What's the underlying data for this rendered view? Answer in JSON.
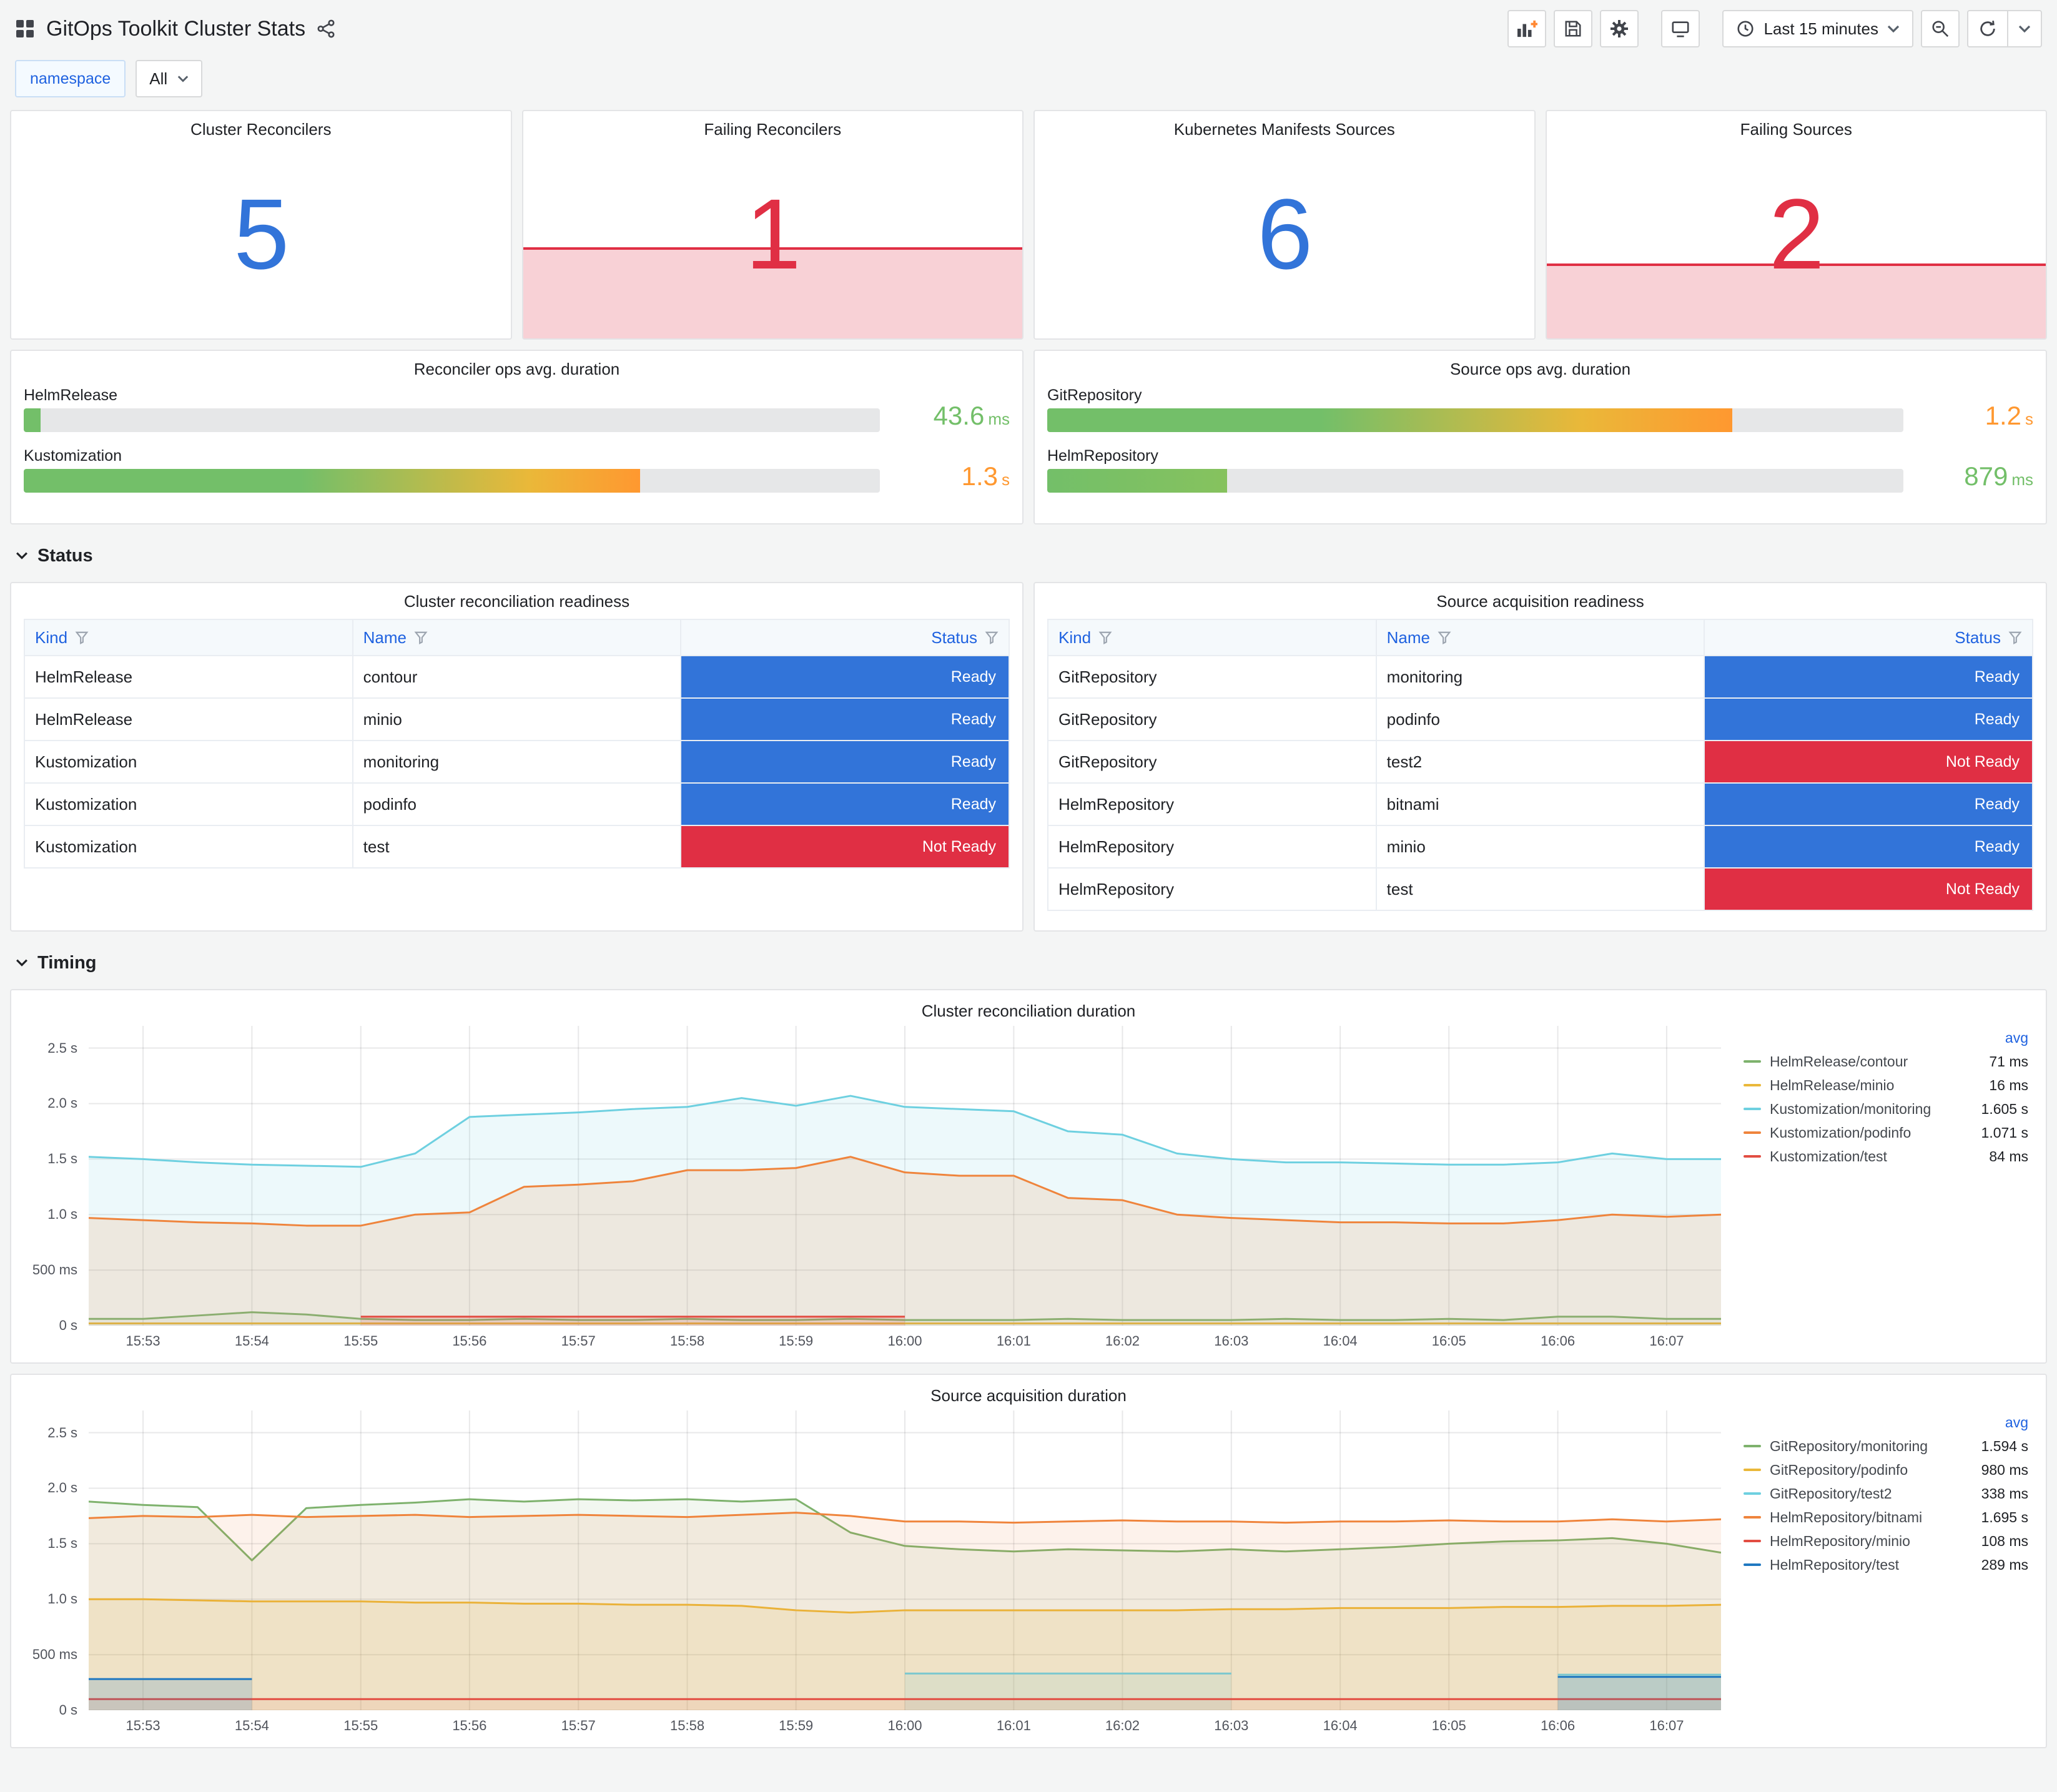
{
  "header": {
    "title": "GitOps Toolkit Cluster Stats",
    "time_range": "Last 15 minutes"
  },
  "variables": {
    "label": "namespace",
    "value": "All"
  },
  "sections": {
    "status": "Status",
    "timing": "Timing"
  },
  "icons": {
    "apps": "grid",
    "share": "share-network",
    "add_panel": "chart-plus",
    "save": "floppy",
    "settings": "gear",
    "tv": "monitor",
    "time": "clock",
    "zoom_out": "magnifier-minus",
    "refresh": "circular-arrow",
    "caret": "chevron-down",
    "filter": "funnel"
  },
  "stats": [
    {
      "title": "Cluster Reconcilers",
      "value": "5",
      "color": "#3274D9",
      "area_pct": 0
    },
    {
      "title": "Failing Reconcilers",
      "value": "1",
      "color": "#E02F44",
      "area_pct": 40,
      "area_color": "rgba(224,47,68,0.22)"
    },
    {
      "title": "Kubernetes Manifests Sources",
      "value": "6",
      "color": "#3274D9",
      "area_pct": 0
    },
    {
      "title": "Failing Sources",
      "value": "2",
      "color": "#E02F44",
      "area_pct": 33,
      "area_color": "rgba(224,47,68,0.22)"
    }
  ],
  "gauges": [
    {
      "title": "Reconciler ops avg. duration",
      "bars": [
        {
          "label": "HelmRelease",
          "value": "43.6",
          "unit": "ms",
          "fraction": 0.02,
          "color": "#73BF69",
          "gradient": [
            "#73BF69 0%",
            "#73BF69 100%"
          ]
        },
        {
          "label": "Kustomization",
          "value": "1.3",
          "unit": "s",
          "fraction": 0.72,
          "color": "#FF9830",
          "gradient": [
            "#73BF69 0%",
            "#73BF69 45%",
            "#EAB839 82%",
            "#FF9830 100%"
          ]
        }
      ]
    },
    {
      "title": "Source ops avg. duration",
      "bars": [
        {
          "label": "GitRepository",
          "value": "1.2",
          "unit": "s",
          "fraction": 0.8,
          "color": "#FF9830",
          "gradient": [
            "#73BF69 0%",
            "#73BF69 40%",
            "#EAB839 78%",
            "#FF9830 100%"
          ]
        },
        {
          "label": "HelmRepository",
          "value": "879",
          "unit": "ms",
          "fraction": 0.21,
          "color": "#73BF69",
          "gradient": [
            "#73BF69 0%",
            "#86C25E 100%"
          ]
        }
      ]
    }
  ],
  "status_section": {
    "status_colors": {
      "Ready": "#3274D9",
      "Not Ready": "#E02F44"
    },
    "tables": [
      {
        "title": "Cluster reconciliation readiness",
        "columns": [
          "Kind",
          "Name",
          "Status"
        ],
        "rows": [
          {
            "kind": "HelmRelease",
            "name": "contour",
            "status": "Ready"
          },
          {
            "kind": "HelmRelease",
            "name": "minio",
            "status": "Ready"
          },
          {
            "kind": "Kustomization",
            "name": "monitoring",
            "status": "Ready"
          },
          {
            "kind": "Kustomization",
            "name": "podinfo",
            "status": "Ready"
          },
          {
            "kind": "Kustomization",
            "name": "test",
            "status": "Not Ready"
          }
        ]
      },
      {
        "title": "Source acquisition readiness",
        "columns": [
          "Kind",
          "Name",
          "Status"
        ],
        "rows": [
          {
            "kind": "GitRepository",
            "name": "monitoring",
            "status": "Ready"
          },
          {
            "kind": "GitRepository",
            "name": "podinfo",
            "status": "Ready"
          },
          {
            "kind": "GitRepository",
            "name": "test2",
            "status": "Not Ready"
          },
          {
            "kind": "HelmRepository",
            "name": "bitnami",
            "status": "Ready"
          },
          {
            "kind": "HelmRepository",
            "name": "minio",
            "status": "Ready"
          },
          {
            "kind": "HelmRepository",
            "name": "test",
            "status": "Not Ready"
          }
        ]
      }
    ]
  },
  "chart_data": [
    {
      "type": "line",
      "title": "Cluster reconciliation duration",
      "legend_header": "avg",
      "ylim": [
        0,
        2.7
      ],
      "yticks": [
        {
          "v": 0,
          "label": "0 s"
        },
        {
          "v": 0.5,
          "label": "500 ms"
        },
        {
          "v": 1,
          "label": "1.0 s"
        },
        {
          "v": 1.5,
          "label": "1.5 s"
        },
        {
          "v": 2,
          "label": "2.0 s"
        },
        {
          "v": 2.5,
          "label": "2.5 s"
        }
      ],
      "xticks": [
        {
          "pos": 0.0333,
          "label": "15:53"
        },
        {
          "pos": 0.1,
          "label": "15:54"
        },
        {
          "pos": 0.1667,
          "label": "15:55"
        },
        {
          "pos": 0.2333,
          "label": "15:56"
        },
        {
          "pos": 0.3,
          "label": "15:57"
        },
        {
          "pos": 0.3667,
          "label": "15:58"
        },
        {
          "pos": 0.4333,
          "label": "15:59"
        },
        {
          "pos": 0.5,
          "label": "16:00"
        },
        {
          "pos": 0.5667,
          "label": "16:01"
        },
        {
          "pos": 0.6333,
          "label": "16:02"
        },
        {
          "pos": 0.7,
          "label": "16:03"
        },
        {
          "pos": 0.7667,
          "label": "16:04"
        },
        {
          "pos": 0.8333,
          "label": "16:05"
        },
        {
          "pos": 0.9,
          "label": "16:06"
        },
        {
          "pos": 0.9667,
          "label": "16:07"
        }
      ],
      "series": [
        {
          "name": "HelmRelease/contour",
          "avg": "71 ms",
          "color": "#7EB26D",
          "fill": 0.08,
          "values": [
            0.06,
            0.06,
            0.09,
            0.12,
            0.1,
            0.06,
            0.05,
            0.05,
            0.06,
            0.05,
            0.05,
            0.06,
            0.05,
            0.05,
            0.06,
            0.05,
            0.05,
            0.05,
            0.06,
            0.05,
            0.05,
            0.05,
            0.06,
            0.05,
            0.05,
            0.06,
            0.05,
            0.08,
            0.08,
            0.06,
            0.06
          ]
        },
        {
          "name": "HelmRelease/minio",
          "avg": "16 ms",
          "color": "#EAB839",
          "fill": 0,
          "values": [
            0.02,
            0.02,
            0.02,
            0.02,
            0.02,
            0.02,
            0.02,
            0.02,
            0.02,
            0.02,
            0.02,
            0.02,
            0.02,
            0.02,
            0.02,
            0.02,
            0.02,
            0.02,
            0.02,
            0.02,
            0.02,
            0.02,
            0.02,
            0.02,
            0.02,
            0.02,
            0.02,
            0.02,
            0.02,
            0.02,
            0.02
          ]
        },
        {
          "name": "Kustomization/monitoring",
          "avg": "1.605 s",
          "color": "#6ED0E0",
          "fill": 0.12,
          "values": [
            1.52,
            1.5,
            1.47,
            1.45,
            1.44,
            1.43,
            1.55,
            1.88,
            1.9,
            1.92,
            1.95,
            1.97,
            2.05,
            1.98,
            2.07,
            1.97,
            1.95,
            1.93,
            1.75,
            1.72,
            1.55,
            1.5,
            1.47,
            1.47,
            1.46,
            1.45,
            1.45,
            1.47,
            1.55,
            1.5,
            1.5
          ]
        },
        {
          "name": "Kustomization/podinfo",
          "avg": "1.071 s",
          "color": "#EF843C",
          "fill": 0.14,
          "values": [
            0.97,
            0.95,
            0.93,
            0.92,
            0.9,
            0.9,
            1.0,
            1.02,
            1.25,
            1.27,
            1.3,
            1.4,
            1.4,
            1.42,
            1.52,
            1.38,
            1.35,
            1.35,
            1.15,
            1.13,
            1.0,
            0.97,
            0.95,
            0.93,
            0.93,
            0.92,
            0.92,
            0.95,
            1.0,
            0.98,
            1.0
          ]
        },
        {
          "name": "Kustomization/test",
          "avg": "84 ms",
          "color": "#E24D42",
          "fill": 0.15,
          "values": [
            null,
            null,
            null,
            null,
            null,
            0.08,
            0.08,
            0.08,
            0.08,
            0.08,
            0.08,
            0.08,
            0.08,
            0.08,
            0.08,
            0.08,
            null,
            null,
            null,
            null,
            null,
            null,
            null,
            null,
            null,
            null,
            null,
            null,
            null,
            null,
            null
          ]
        }
      ]
    },
    {
      "type": "line",
      "title": "Source acquisition duration",
      "legend_header": "avg",
      "ylim": [
        0,
        2.7
      ],
      "yticks": [
        {
          "v": 0,
          "label": "0 s"
        },
        {
          "v": 0.5,
          "label": "500 ms"
        },
        {
          "v": 1,
          "label": "1.0 s"
        },
        {
          "v": 1.5,
          "label": "1.5 s"
        },
        {
          "v": 2,
          "label": "2.0 s"
        },
        {
          "v": 2.5,
          "label": "2.5 s"
        }
      ],
      "xticks": [
        {
          "pos": 0.0333,
          "label": "15:53"
        },
        {
          "pos": 0.1,
          "label": "15:54"
        },
        {
          "pos": 0.1667,
          "label": "15:55"
        },
        {
          "pos": 0.2333,
          "label": "15:56"
        },
        {
          "pos": 0.3,
          "label": "15:57"
        },
        {
          "pos": 0.3667,
          "label": "15:58"
        },
        {
          "pos": 0.4333,
          "label": "15:59"
        },
        {
          "pos": 0.5,
          "label": "16:00"
        },
        {
          "pos": 0.5667,
          "label": "16:01"
        },
        {
          "pos": 0.6333,
          "label": "16:02"
        },
        {
          "pos": 0.7,
          "label": "16:03"
        },
        {
          "pos": 0.7667,
          "label": "16:04"
        },
        {
          "pos": 0.8333,
          "label": "16:05"
        },
        {
          "pos": 0.9,
          "label": "16:06"
        },
        {
          "pos": 0.9667,
          "label": "16:07"
        }
      ],
      "series": [
        {
          "name": "GitRepository/monitoring",
          "avg": "1.594 s",
          "color": "#7EB26D",
          "fill": 0.1,
          "values": [
            1.88,
            1.85,
            1.83,
            1.35,
            1.82,
            1.85,
            1.87,
            1.9,
            1.88,
            1.9,
            1.89,
            1.9,
            1.88,
            1.9,
            1.6,
            1.48,
            1.45,
            1.43,
            1.45,
            1.44,
            1.43,
            1.45,
            1.43,
            1.45,
            1.47,
            1.5,
            1.52,
            1.53,
            1.55,
            1.5,
            1.42
          ]
        },
        {
          "name": "GitRepository/podinfo",
          "avg": "980 ms",
          "color": "#EAB839",
          "fill": 0.14,
          "values": [
            1.0,
            1.0,
            0.99,
            0.98,
            0.98,
            0.98,
            0.97,
            0.97,
            0.96,
            0.96,
            0.95,
            0.95,
            0.94,
            0.9,
            0.88,
            0.9,
            0.9,
            0.9,
            0.9,
            0.9,
            0.9,
            0.91,
            0.91,
            0.92,
            0.92,
            0.92,
            0.93,
            0.93,
            0.94,
            0.94,
            0.95
          ]
        },
        {
          "name": "GitRepository/test2",
          "avg": "338 ms",
          "color": "#6ED0E0",
          "fill": 0.15,
          "values": [
            null,
            null,
            null,
            null,
            null,
            null,
            null,
            null,
            null,
            null,
            null,
            null,
            null,
            null,
            null,
            0.33,
            0.33,
            0.33,
            0.33,
            0.33,
            0.33,
            0.33,
            null,
            null,
            null,
            null,
            null,
            0.32,
            0.32,
            0.32,
            0.32
          ]
        },
        {
          "name": "HelmRepository/bitnami",
          "avg": "1.695 s",
          "color": "#EF843C",
          "fill": 0.1,
          "values": [
            1.73,
            1.75,
            1.74,
            1.76,
            1.74,
            1.75,
            1.76,
            1.74,
            1.75,
            1.76,
            1.75,
            1.74,
            1.76,
            1.78,
            1.75,
            1.7,
            1.7,
            1.69,
            1.7,
            1.71,
            1.7,
            1.7,
            1.69,
            1.7,
            1.7,
            1.71,
            1.7,
            1.7,
            1.72,
            1.7,
            1.72
          ]
        },
        {
          "name": "HelmRepository/minio",
          "avg": "108 ms",
          "color": "#E24D42",
          "fill": 0.08,
          "values": [
            0.1,
            0.1,
            0.1,
            0.1,
            0.1,
            0.1,
            0.1,
            0.1,
            0.1,
            0.1,
            0.1,
            0.1,
            0.1,
            0.1,
            0.1,
            0.1,
            0.1,
            0.1,
            0.1,
            0.1,
            0.1,
            0.1,
            0.1,
            0.1,
            0.1,
            0.1,
            0.1,
            0.1,
            0.1,
            0.1,
            0.1
          ]
        },
        {
          "name": "HelmRepository/test",
          "avg": "289 ms",
          "color": "#1F78C1",
          "fill": 0.18,
          "values": [
            0.28,
            0.28,
            0.28,
            0.28,
            null,
            null,
            null,
            null,
            null,
            null,
            null,
            null,
            null,
            null,
            null,
            null,
            null,
            null,
            null,
            null,
            null,
            null,
            null,
            null,
            null,
            null,
            null,
            0.3,
            0.3,
            0.3,
            0.3
          ]
        }
      ]
    }
  ]
}
